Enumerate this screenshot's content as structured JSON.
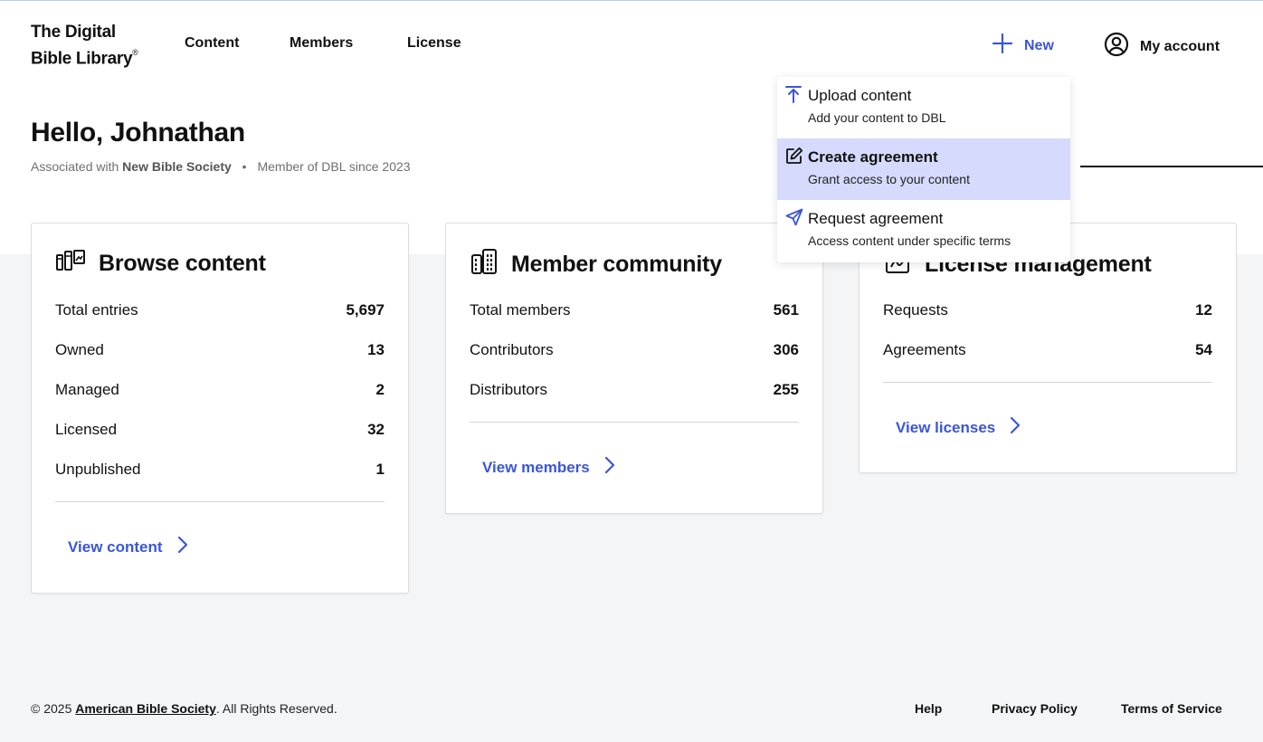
{
  "header": {
    "logo_line1": "The Digital",
    "logo_line2": "Bible Library",
    "logo_mark": "®",
    "nav": [
      "Content",
      "Members",
      "License"
    ],
    "new_label": "New",
    "account_label": "My account"
  },
  "greeting": {
    "title": "Hello, Johnathan",
    "assoc_prefix": "Associated with",
    "org": "New Bible Society",
    "member_since": "Member of DBL since 2023"
  },
  "cards": {
    "browse": {
      "title": "Browse content",
      "icon": "library-icon",
      "stats": [
        {
          "label": "Total entries",
          "value": "5,697"
        },
        {
          "label": "Owned",
          "value": "13"
        },
        {
          "label": "Managed",
          "value": "2"
        },
        {
          "label": "Licensed",
          "value": "32"
        },
        {
          "label": "Unpublished",
          "value": "1"
        }
      ],
      "link": "View content"
    },
    "members": {
      "title": "Member community",
      "icon": "building-icon",
      "stats": [
        {
          "label": "Total members",
          "value": "561"
        },
        {
          "label": "Contributors",
          "value": "306"
        },
        {
          "label": "Distributors",
          "value": "255"
        }
      ],
      "link": "View members"
    },
    "license": {
      "title": "License management",
      "icon": "license-icon",
      "stats": [
        {
          "label": "Requests",
          "value": "12"
        },
        {
          "label": "Agreements",
          "value": "54"
        }
      ],
      "link": "View licenses"
    }
  },
  "new_menu": {
    "items": [
      {
        "title": "Upload content",
        "subtitle": "Add your content to DBL",
        "icon": "upload-icon"
      },
      {
        "title": "Create agreement",
        "subtitle": "Grant access to your content",
        "icon": "edit-icon"
      },
      {
        "title": "Request agreement",
        "subtitle": "Access content under specific terms",
        "icon": "send-icon"
      }
    ]
  },
  "footer": {
    "copyright_prefix": "© 2025",
    "org": "American Bible Society",
    "copyright_suffix": ". All Rights Reserved.",
    "links": [
      "Help",
      "Privacy Policy",
      "Terms of Service"
    ]
  },
  "colors": {
    "accent": "#3b55d9",
    "menu_active": "#d6dafc",
    "page_bg": "#f4f5f6"
  }
}
